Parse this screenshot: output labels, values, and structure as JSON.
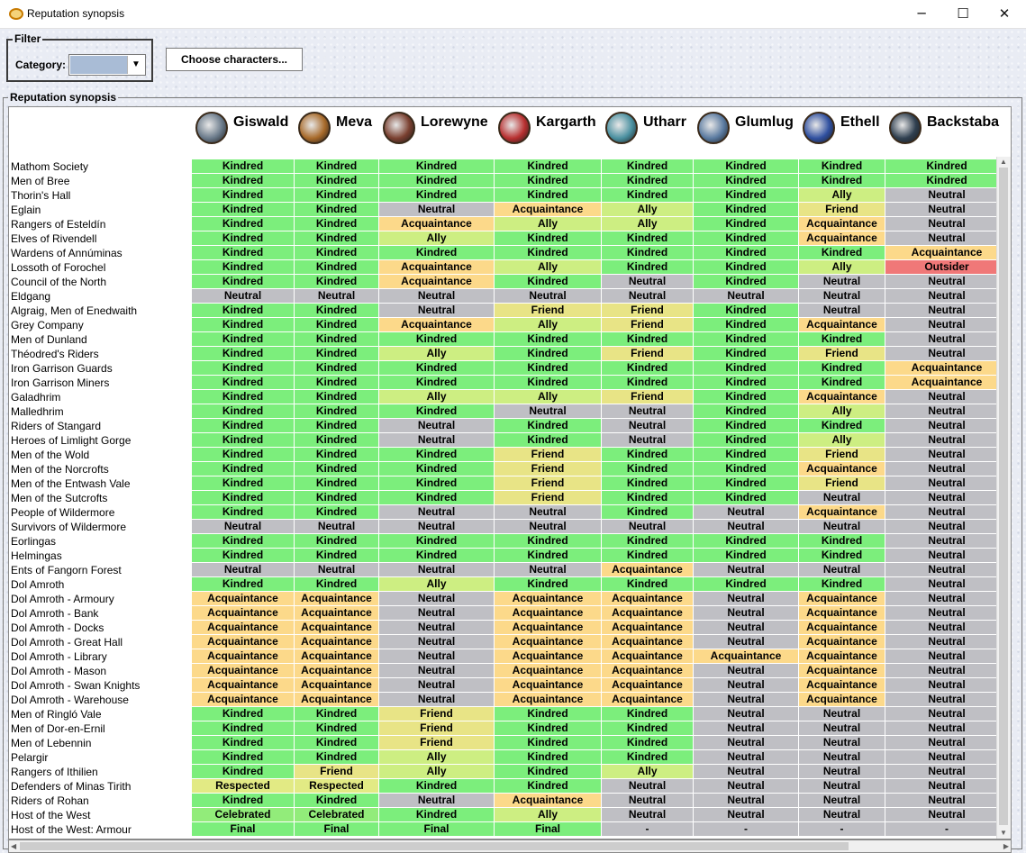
{
  "window": {
    "title": "Reputation synopsis",
    "minimize": "─",
    "maximize": "☐",
    "close": "✕"
  },
  "filter": {
    "legend": "Filter",
    "category_label": "Category:",
    "category_value": "",
    "choose_button": "Choose characters..."
  },
  "synopsis": {
    "legend": "Reputation synopsis"
  },
  "colors": {
    "Kindred": "#7cee7c",
    "Ally": "#cdee82",
    "Friend": "#e8e486",
    "Acquaintance": "#fcd98a",
    "Neutral": "#bfbfc4",
    "Outsider": "#f07878",
    "Respected": "#e2ea84",
    "Celebrated": "#92ec7a",
    "Final": "#7cee7c",
    "-": "#bfbfc4"
  },
  "characters": [
    {
      "name": "Giswald",
      "avatar": "crossed-swords-avatar-icon",
      "tint": "#6a7a8a"
    },
    {
      "name": "Meva",
      "avatar": "harp-avatar-icon",
      "tint": "#a86a2a"
    },
    {
      "name": "Lorewyne",
      "avatar": "book-avatar-icon",
      "tint": "#7a4030"
    },
    {
      "name": "Kargarth",
      "avatar": "shield-avatar-icon",
      "tint": "#b83030"
    },
    {
      "name": "Utharr",
      "avatar": "rune-stone-avatar-icon",
      "tint": "#4a90a0"
    },
    {
      "name": "Glumlug",
      "avatar": "staff-avatar-icon",
      "tint": "#5a7aa0"
    },
    {
      "name": "Ethell",
      "avatar": "banner-avatar-icon",
      "tint": "#3050a0"
    },
    {
      "name": "Backstaba",
      "avatar": "dagger-avatar-icon",
      "tint": "#304050"
    }
  ],
  "rows": [
    {
      "faction": "Mathom Society",
      "values": [
        "Kindred",
        "Kindred",
        "Kindred",
        "Kindred",
        "Kindred",
        "Kindred",
        "Kindred",
        "Kindred"
      ]
    },
    {
      "faction": "Men of Bree",
      "values": [
        "Kindred",
        "Kindred",
        "Kindred",
        "Kindred",
        "Kindred",
        "Kindred",
        "Kindred",
        "Kindred"
      ]
    },
    {
      "faction": "Thorin's Hall",
      "values": [
        "Kindred",
        "Kindred",
        "Kindred",
        "Kindred",
        "Kindred",
        "Kindred",
        "Ally",
        "Neutral"
      ]
    },
    {
      "faction": "Eglain",
      "values": [
        "Kindred",
        "Kindred",
        "Neutral",
        "Acquaintance",
        "Ally",
        "Kindred",
        "Friend",
        "Neutral"
      ]
    },
    {
      "faction": "Rangers of Esteldín",
      "values": [
        "Kindred",
        "Kindred",
        "Acquaintance",
        "Ally",
        "Ally",
        "Kindred",
        "Acquaintance",
        "Neutral"
      ]
    },
    {
      "faction": "Elves of Rivendell",
      "values": [
        "Kindred",
        "Kindred",
        "Ally",
        "Kindred",
        "Kindred",
        "Kindred",
        "Acquaintance",
        "Neutral"
      ]
    },
    {
      "faction": "Wardens of Annúminas",
      "values": [
        "Kindred",
        "Kindred",
        "Kindred",
        "Kindred",
        "Kindred",
        "Kindred",
        "Kindred",
        "Acquaintance"
      ]
    },
    {
      "faction": "Lossoth of Forochel",
      "values": [
        "Kindred",
        "Kindred",
        "Acquaintance",
        "Ally",
        "Kindred",
        "Kindred",
        "Ally",
        "Outsider"
      ]
    },
    {
      "faction": "Council of the North",
      "values": [
        "Kindred",
        "Kindred",
        "Acquaintance",
        "Kindred",
        "Neutral",
        "Kindred",
        "Neutral",
        "Neutral"
      ]
    },
    {
      "faction": "Eldgang",
      "values": [
        "Neutral",
        "Neutral",
        "Neutral",
        "Neutral",
        "Neutral",
        "Neutral",
        "Neutral",
        "Neutral"
      ]
    },
    {
      "faction": "Algraig, Men of Enedwaith",
      "values": [
        "Kindred",
        "Kindred",
        "Neutral",
        "Friend",
        "Friend",
        "Kindred",
        "Neutral",
        "Neutral"
      ]
    },
    {
      "faction": "Grey Company",
      "values": [
        "Kindred",
        "Kindred",
        "Acquaintance",
        "Ally",
        "Friend",
        "Kindred",
        "Acquaintance",
        "Neutral"
      ]
    },
    {
      "faction": "Men of Dunland",
      "values": [
        "Kindred",
        "Kindred",
        "Kindred",
        "Kindred",
        "Kindred",
        "Kindred",
        "Kindred",
        "Neutral"
      ]
    },
    {
      "faction": "Théodred's Riders",
      "values": [
        "Kindred",
        "Kindred",
        "Ally",
        "Kindred",
        "Friend",
        "Kindred",
        "Friend",
        "Neutral"
      ]
    },
    {
      "faction": "Iron Garrison Guards",
      "values": [
        "Kindred",
        "Kindred",
        "Kindred",
        "Kindred",
        "Kindred",
        "Kindred",
        "Kindred",
        "Acquaintance"
      ]
    },
    {
      "faction": "Iron Garrison Miners",
      "values": [
        "Kindred",
        "Kindred",
        "Kindred",
        "Kindred",
        "Kindred",
        "Kindred",
        "Kindred",
        "Acquaintance"
      ]
    },
    {
      "faction": "Galadhrim",
      "values": [
        "Kindred",
        "Kindred",
        "Ally",
        "Ally",
        "Friend",
        "Kindred",
        "Acquaintance",
        "Neutral"
      ]
    },
    {
      "faction": "Malledhrim",
      "values": [
        "Kindred",
        "Kindred",
        "Kindred",
        "Neutral",
        "Neutral",
        "Kindred",
        "Ally",
        "Neutral"
      ]
    },
    {
      "faction": "Riders of Stangard",
      "values": [
        "Kindred",
        "Kindred",
        "Neutral",
        "Kindred",
        "Neutral",
        "Kindred",
        "Kindred",
        "Neutral"
      ]
    },
    {
      "faction": "Heroes of Limlight Gorge",
      "values": [
        "Kindred",
        "Kindred",
        "Neutral",
        "Kindred",
        "Neutral",
        "Kindred",
        "Ally",
        "Neutral"
      ]
    },
    {
      "faction": "Men of the Wold",
      "values": [
        "Kindred",
        "Kindred",
        "Kindred",
        "Friend",
        "Kindred",
        "Kindred",
        "Friend",
        "Neutral"
      ]
    },
    {
      "faction": "Men of the Norcrofts",
      "values": [
        "Kindred",
        "Kindred",
        "Kindred",
        "Friend",
        "Kindred",
        "Kindred",
        "Acquaintance",
        "Neutral"
      ]
    },
    {
      "faction": "Men of the Entwash Vale",
      "values": [
        "Kindred",
        "Kindred",
        "Kindred",
        "Friend",
        "Kindred",
        "Kindred",
        "Friend",
        "Neutral"
      ]
    },
    {
      "faction": "Men of the Sutcrofts",
      "values": [
        "Kindred",
        "Kindred",
        "Kindred",
        "Friend",
        "Kindred",
        "Kindred",
        "Neutral",
        "Neutral"
      ]
    },
    {
      "faction": "People of Wildermore",
      "values": [
        "Kindred",
        "Kindred",
        "Neutral",
        "Neutral",
        "Kindred",
        "Neutral",
        "Acquaintance",
        "Neutral"
      ]
    },
    {
      "faction": "Survivors of Wildermore",
      "values": [
        "Neutral",
        "Neutral",
        "Neutral",
        "Neutral",
        "Neutral",
        "Neutral",
        "Neutral",
        "Neutral"
      ]
    },
    {
      "faction": "Eorlingas",
      "values": [
        "Kindred",
        "Kindred",
        "Kindred",
        "Kindred",
        "Kindred",
        "Kindred",
        "Kindred",
        "Neutral"
      ]
    },
    {
      "faction": "Helmingas",
      "values": [
        "Kindred",
        "Kindred",
        "Kindred",
        "Kindred",
        "Kindred",
        "Kindred",
        "Kindred",
        "Neutral"
      ]
    },
    {
      "faction": "Ents of Fangorn Forest",
      "values": [
        "Neutral",
        "Neutral",
        "Neutral",
        "Neutral",
        "Acquaintance",
        "Neutral",
        "Neutral",
        "Neutral"
      ]
    },
    {
      "faction": "Dol Amroth",
      "values": [
        "Kindred",
        "Kindred",
        "Ally",
        "Kindred",
        "Kindred",
        "Kindred",
        "Kindred",
        "Neutral"
      ]
    },
    {
      "faction": "Dol Amroth - Armoury",
      "values": [
        "Acquaintance",
        "Acquaintance",
        "Neutral",
        "Acquaintance",
        "Acquaintance",
        "Neutral",
        "Acquaintance",
        "Neutral"
      ]
    },
    {
      "faction": "Dol Amroth - Bank",
      "values": [
        "Acquaintance",
        "Acquaintance",
        "Neutral",
        "Acquaintance",
        "Acquaintance",
        "Neutral",
        "Acquaintance",
        "Neutral"
      ]
    },
    {
      "faction": "Dol Amroth - Docks",
      "values": [
        "Acquaintance",
        "Acquaintance",
        "Neutral",
        "Acquaintance",
        "Acquaintance",
        "Neutral",
        "Acquaintance",
        "Neutral"
      ]
    },
    {
      "faction": "Dol Amroth - Great Hall",
      "values": [
        "Acquaintance",
        "Acquaintance",
        "Neutral",
        "Acquaintance",
        "Acquaintance",
        "Neutral",
        "Acquaintance",
        "Neutral"
      ]
    },
    {
      "faction": "Dol Amroth - Library",
      "values": [
        "Acquaintance",
        "Acquaintance",
        "Neutral",
        "Acquaintance",
        "Acquaintance",
        "Acquaintance",
        "Acquaintance",
        "Neutral"
      ]
    },
    {
      "faction": "Dol Amroth - Mason",
      "values": [
        "Acquaintance",
        "Acquaintance",
        "Neutral",
        "Acquaintance",
        "Acquaintance",
        "Neutral",
        "Acquaintance",
        "Neutral"
      ]
    },
    {
      "faction": "Dol Amroth - Swan Knights",
      "values": [
        "Acquaintance",
        "Acquaintance",
        "Neutral",
        "Acquaintance",
        "Acquaintance",
        "Neutral",
        "Acquaintance",
        "Neutral"
      ]
    },
    {
      "faction": "Dol Amroth - Warehouse",
      "values": [
        "Acquaintance",
        "Acquaintance",
        "Neutral",
        "Acquaintance",
        "Acquaintance",
        "Neutral",
        "Acquaintance",
        "Neutral"
      ]
    },
    {
      "faction": "Men of Ringló Vale",
      "values": [
        "Kindred",
        "Kindred",
        "Friend",
        "Kindred",
        "Kindred",
        "Neutral",
        "Neutral",
        "Neutral"
      ]
    },
    {
      "faction": "Men of Dor-en-Ernil",
      "values": [
        "Kindred",
        "Kindred",
        "Friend",
        "Kindred",
        "Kindred",
        "Neutral",
        "Neutral",
        "Neutral"
      ]
    },
    {
      "faction": "Men of Lebennin",
      "values": [
        "Kindred",
        "Kindred",
        "Friend",
        "Kindred",
        "Kindred",
        "Neutral",
        "Neutral",
        "Neutral"
      ]
    },
    {
      "faction": "Pelargir",
      "values": [
        "Kindred",
        "Kindred",
        "Ally",
        "Kindred",
        "Kindred",
        "Neutral",
        "Neutral",
        "Neutral"
      ]
    },
    {
      "faction": "Rangers of Ithilien",
      "values": [
        "Kindred",
        "Friend",
        "Ally",
        "Kindred",
        "Ally",
        "Neutral",
        "Neutral",
        "Neutral"
      ]
    },
    {
      "faction": "Defenders of Minas Tirith",
      "values": [
        "Respected",
        "Respected",
        "Kindred",
        "Kindred",
        "Neutral",
        "Neutral",
        "Neutral",
        "Neutral"
      ]
    },
    {
      "faction": "Riders of Rohan",
      "values": [
        "Kindred",
        "Kindred",
        "Neutral",
        "Acquaintance",
        "Neutral",
        "Neutral",
        "Neutral",
        "Neutral"
      ]
    },
    {
      "faction": "Host of the West",
      "values": [
        "Celebrated",
        "Celebrated",
        "Kindred",
        "Ally",
        "Neutral",
        "Neutral",
        "Neutral",
        "Neutral"
      ]
    },
    {
      "faction": "Host of the West: Armour",
      "values": [
        "Final",
        "Final",
        "Final",
        "Final",
        "-",
        "-",
        "-",
        "-"
      ]
    }
  ]
}
